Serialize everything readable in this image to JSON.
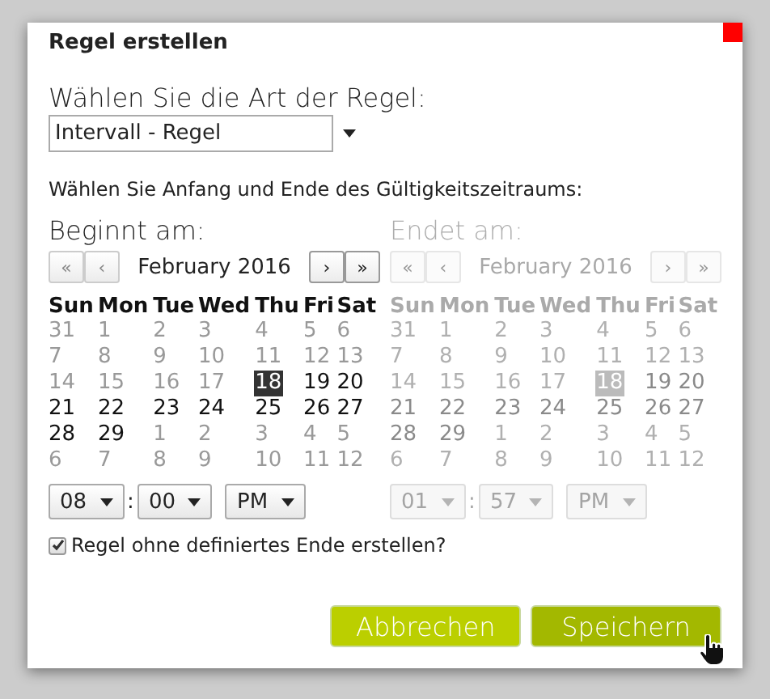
{
  "dialog": {
    "title": "Regel erstellen",
    "close_marker": true
  },
  "rule_type": {
    "label": "Wählen Sie die Art der Regel:",
    "value": "Intervall - Regel"
  },
  "period_hint": "Wählen Sie Anfang und Ende des Gültigkeitszeitraums:",
  "pickers": [
    {
      "label": "Beginnt am:",
      "disabled": false,
      "nav_prev": [
        "«",
        "‹"
      ],
      "month": "February 2016",
      "nav_next": [
        "›",
        "»"
      ],
      "weekdays": [
        "Sun",
        "Mon",
        "Tue",
        "Wed",
        "Thu",
        "Fri",
        "Sat"
      ],
      "weeks": [
        [
          {
            "text": "31",
            "muted": true,
            "selected": false
          },
          {
            "text": "1",
            "muted": true,
            "selected": false
          },
          {
            "text": "2",
            "muted": true,
            "selected": false
          },
          {
            "text": "3",
            "muted": true,
            "selected": false
          },
          {
            "text": "4",
            "muted": true,
            "selected": false
          },
          {
            "text": "5",
            "muted": true,
            "selected": false
          },
          {
            "text": "6",
            "muted": true,
            "selected": false
          }
        ],
        [
          {
            "text": "7",
            "muted": true,
            "selected": false
          },
          {
            "text": "8",
            "muted": true,
            "selected": false
          },
          {
            "text": "9",
            "muted": true,
            "selected": false
          },
          {
            "text": "10",
            "muted": true,
            "selected": false
          },
          {
            "text": "11",
            "muted": true,
            "selected": false
          },
          {
            "text": "12",
            "muted": true,
            "selected": false
          },
          {
            "text": "13",
            "muted": true,
            "selected": false
          }
        ],
        [
          {
            "text": "14",
            "muted": true,
            "selected": false
          },
          {
            "text": "15",
            "muted": true,
            "selected": false
          },
          {
            "text": "16",
            "muted": true,
            "selected": false
          },
          {
            "text": "17",
            "muted": true,
            "selected": false
          },
          {
            "text": "18",
            "muted": false,
            "selected": true
          },
          {
            "text": "19",
            "muted": false,
            "selected": false
          },
          {
            "text": "20",
            "muted": false,
            "selected": false
          }
        ],
        [
          {
            "text": "21",
            "muted": false,
            "selected": false
          },
          {
            "text": "22",
            "muted": false,
            "selected": false
          },
          {
            "text": "23",
            "muted": false,
            "selected": false
          },
          {
            "text": "24",
            "muted": false,
            "selected": false
          },
          {
            "text": "25",
            "muted": false,
            "selected": false
          },
          {
            "text": "26",
            "muted": false,
            "selected": false
          },
          {
            "text": "27",
            "muted": false,
            "selected": false
          }
        ],
        [
          {
            "text": "28",
            "muted": false,
            "selected": false
          },
          {
            "text": "29",
            "muted": false,
            "selected": false
          },
          {
            "text": "1",
            "muted": true,
            "selected": false
          },
          {
            "text": "2",
            "muted": true,
            "selected": false
          },
          {
            "text": "3",
            "muted": true,
            "selected": false
          },
          {
            "text": "4",
            "muted": true,
            "selected": false
          },
          {
            "text": "5",
            "muted": true,
            "selected": false
          }
        ],
        [
          {
            "text": "6",
            "muted": true,
            "selected": false
          },
          {
            "text": "7",
            "muted": true,
            "selected": false
          },
          {
            "text": "8",
            "muted": true,
            "selected": false
          },
          {
            "text": "9",
            "muted": true,
            "selected": false
          },
          {
            "text": "10",
            "muted": true,
            "selected": false
          },
          {
            "text": "11",
            "muted": true,
            "selected": false
          },
          {
            "text": "12",
            "muted": true,
            "selected": false
          }
        ]
      ],
      "hour": "08",
      "separator": ":",
      "minute": "00",
      "ampm": "PM"
    },
    {
      "label": "Endet am:",
      "disabled": true,
      "nav_prev": [
        "«",
        "‹"
      ],
      "month": "February 2016",
      "nav_next": [
        "›",
        "»"
      ],
      "weekdays": [
        "Sun",
        "Mon",
        "Tue",
        "Wed",
        "Thu",
        "Fri",
        "Sat"
      ],
      "weeks": [
        [
          {
            "text": "31",
            "muted": true,
            "selected": false
          },
          {
            "text": "1",
            "muted": true,
            "selected": false
          },
          {
            "text": "2",
            "muted": true,
            "selected": false
          },
          {
            "text": "3",
            "muted": true,
            "selected": false
          },
          {
            "text": "4",
            "muted": true,
            "selected": false
          },
          {
            "text": "5",
            "muted": true,
            "selected": false
          },
          {
            "text": "6",
            "muted": true,
            "selected": false
          }
        ],
        [
          {
            "text": "7",
            "muted": true,
            "selected": false
          },
          {
            "text": "8",
            "muted": true,
            "selected": false
          },
          {
            "text": "9",
            "muted": true,
            "selected": false
          },
          {
            "text": "10",
            "muted": true,
            "selected": false
          },
          {
            "text": "11",
            "muted": true,
            "selected": false
          },
          {
            "text": "12",
            "muted": true,
            "selected": false
          },
          {
            "text": "13",
            "muted": true,
            "selected": false
          }
        ],
        [
          {
            "text": "14",
            "muted": true,
            "selected": false
          },
          {
            "text": "15",
            "muted": true,
            "selected": false
          },
          {
            "text": "16",
            "muted": true,
            "selected": false
          },
          {
            "text": "17",
            "muted": true,
            "selected": false
          },
          {
            "text": "18",
            "muted": false,
            "selected": true
          },
          {
            "text": "19",
            "muted": false,
            "selected": false
          },
          {
            "text": "20",
            "muted": false,
            "selected": false
          }
        ],
        [
          {
            "text": "21",
            "muted": false,
            "selected": false
          },
          {
            "text": "22",
            "muted": false,
            "selected": false
          },
          {
            "text": "23",
            "muted": false,
            "selected": false
          },
          {
            "text": "24",
            "muted": false,
            "selected": false
          },
          {
            "text": "25",
            "muted": false,
            "selected": false
          },
          {
            "text": "26",
            "muted": false,
            "selected": false
          },
          {
            "text": "27",
            "muted": false,
            "selected": false
          }
        ],
        [
          {
            "text": "28",
            "muted": false,
            "selected": false
          },
          {
            "text": "29",
            "muted": false,
            "selected": false
          },
          {
            "text": "1",
            "muted": true,
            "selected": false
          },
          {
            "text": "2",
            "muted": true,
            "selected": false
          },
          {
            "text": "3",
            "muted": true,
            "selected": false
          },
          {
            "text": "4",
            "muted": true,
            "selected": false
          },
          {
            "text": "5",
            "muted": true,
            "selected": false
          }
        ],
        [
          {
            "text": "6",
            "muted": true,
            "selected": false
          },
          {
            "text": "7",
            "muted": true,
            "selected": false
          },
          {
            "text": "8",
            "muted": true,
            "selected": false
          },
          {
            "text": "9",
            "muted": true,
            "selected": false
          },
          {
            "text": "10",
            "muted": true,
            "selected": false
          },
          {
            "text": "11",
            "muted": true,
            "selected": false
          },
          {
            "text": "12",
            "muted": true,
            "selected": false
          }
        ]
      ],
      "hour": "01",
      "separator": ":",
      "minute": "57",
      "ampm": "PM"
    }
  ],
  "open_end": {
    "label": "Regel ohne definiertes Ende erstellen?",
    "checked": true
  },
  "buttons": [
    {
      "label": "Abbrechen",
      "hovered": false
    },
    {
      "label": "Speichern",
      "hovered": true
    }
  ]
}
